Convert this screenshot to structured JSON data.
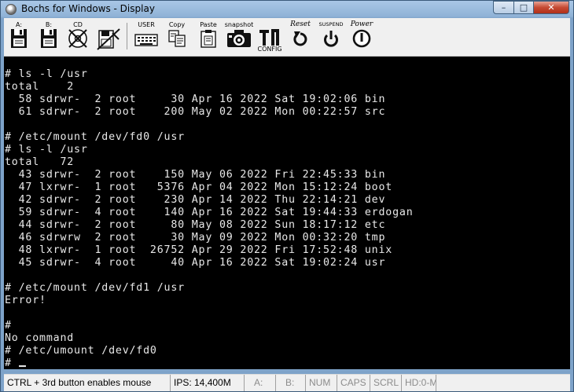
{
  "window": {
    "title": "Bochs for Windows - Display",
    "minimize_glyph": "–",
    "maximize_glyph": "□",
    "close_glyph": "✕"
  },
  "toolbar": {
    "floppy_a": "A:",
    "floppy_b": "B:",
    "cd": "CD",
    "user": "USER",
    "copy": "Copy",
    "paste": "Paste",
    "snapshot": "snapshot",
    "config": "CONFIG",
    "reset": "Reset",
    "suspend": "SUSPEND",
    "power": "Power"
  },
  "terminal": {
    "lines": [
      "# ls -l /usr",
      "total    2",
      "  58 sdrwr-  2 root     30 Apr 16 2022 Sat 19:02:06 bin",
      "  61 sdrwr-  2 root    200 May 02 2022 Mon 00:22:57 src",
      "",
      "# /etc/mount /dev/fd0 /usr",
      "# ls -l /usr",
      "total   72",
      "  43 sdrwr-  2 root    150 May 06 2022 Fri 22:45:33 bin",
      "  47 lxrwr-  1 root   5376 Apr 04 2022 Mon 15:12:24 boot",
      "  42 sdrwr-  2 root    230 Apr 14 2022 Thu 22:14:21 dev",
      "  59 sdrwr-  4 root    140 Apr 16 2022 Sat 19:44:33 erdogan",
      "  44 sdrwr-  2 root     80 May 08 2022 Sun 18:17:12 etc",
      "  46 sdrwrw  2 root     30 May 09 2022 Mon 00:32:20 tmp",
      "  48 lxrwr-  1 root  26752 Apr 29 2022 Fri 17:52:48 unix",
      "  45 sdrwr-  4 root     40 Apr 16 2022 Sat 19:02:24 usr",
      "",
      "# /etc/mount /dev/fd1 /usr",
      "Error!",
      "",
      "#",
      "No command",
      "# /etc/umount /dev/fd0",
      "# "
    ]
  },
  "statusbar": {
    "hint": "CTRL + 3rd button enables mouse",
    "ips": "IPS: 14,400M",
    "a": "A:",
    "b": "B:",
    "num": "NUM",
    "caps": "CAPS",
    "scrl": "SCRL",
    "hd": "HD:0-M"
  }
}
